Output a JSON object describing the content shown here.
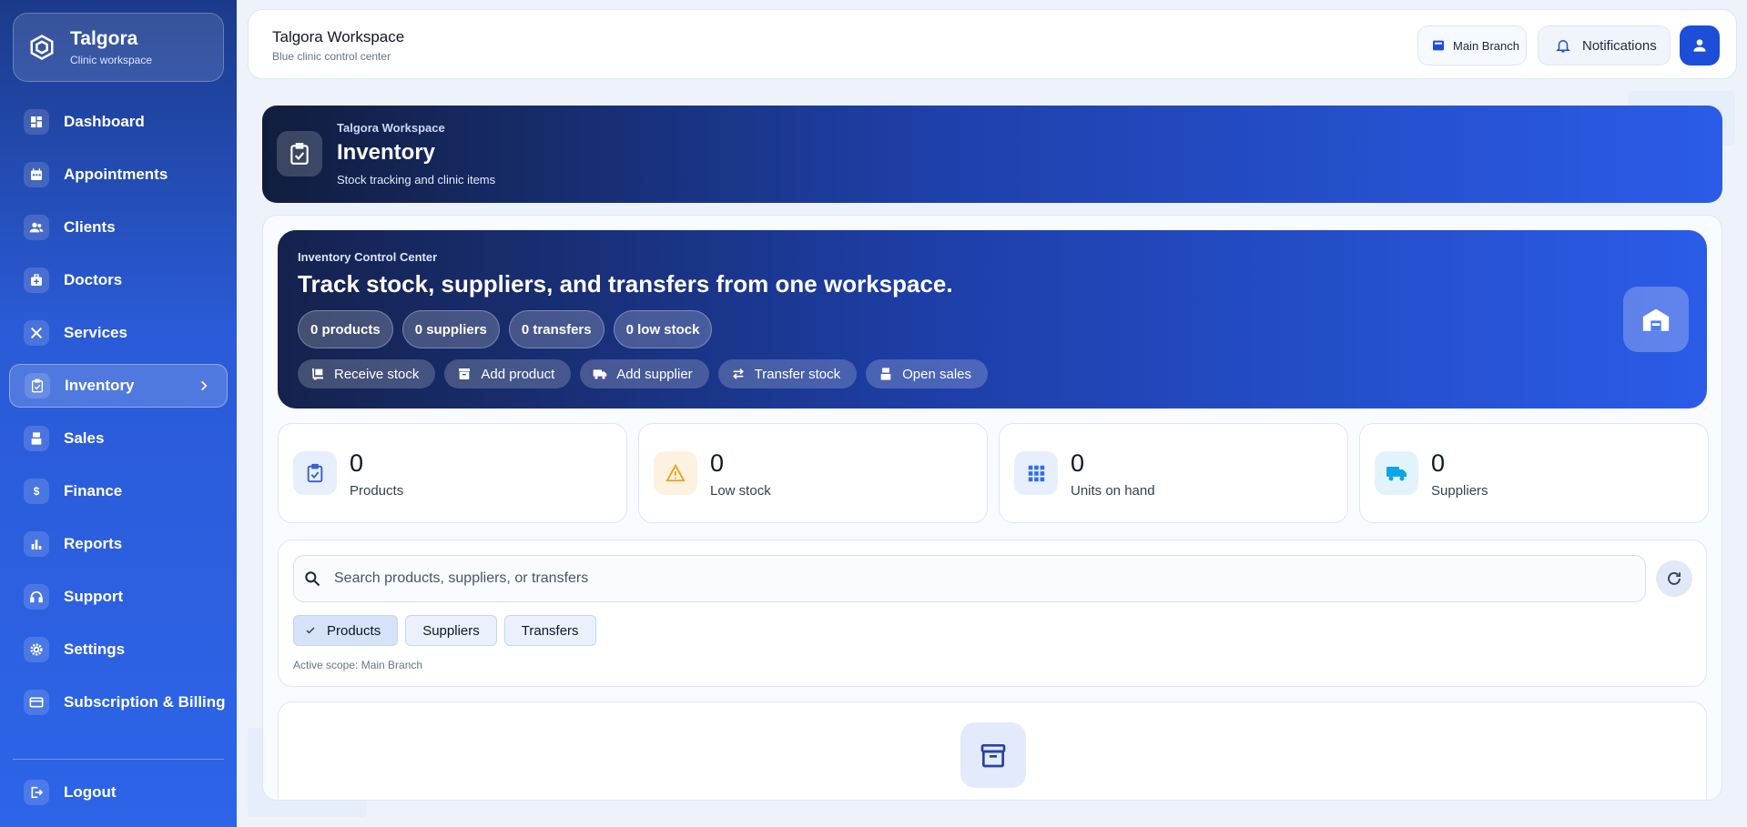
{
  "sidebar": {
    "brand_title": "Talgora",
    "brand_subtitle": "Clinic workspace",
    "items": [
      {
        "label": "Dashboard",
        "icon": "dashboard-icon"
      },
      {
        "label": "Appointments",
        "icon": "calendar-icon"
      },
      {
        "label": "Clients",
        "icon": "users-icon"
      },
      {
        "label": "Doctors",
        "icon": "medical-bag-icon"
      },
      {
        "label": "Services",
        "icon": "tools-icon"
      },
      {
        "label": "Inventory",
        "icon": "clipboard-check-icon",
        "active": true
      },
      {
        "label": "Sales",
        "icon": "register-icon"
      },
      {
        "label": "Finance",
        "icon": "dollar-icon"
      },
      {
        "label": "Reports",
        "icon": "bar-chart-icon"
      },
      {
        "label": "Support",
        "icon": "headset-icon"
      },
      {
        "label": "Settings",
        "icon": "gear-icon"
      },
      {
        "label": "Subscription & Billing",
        "icon": "credit-card-icon"
      }
    ],
    "logout_label": "Logout"
  },
  "topbar": {
    "title": "Talgora Workspace",
    "subtitle": "Blue clinic control center",
    "branch_label": "Main Branch",
    "notifications_label": "Notifications"
  },
  "page_header": {
    "kicker": "Talgora Workspace",
    "title": "Inventory",
    "subtitle": "Stock tracking and clinic items"
  },
  "control_center": {
    "kicker": "Inventory Control Center",
    "title": "Track stock, suppliers, and transfers from one workspace.",
    "chips": [
      "0 products",
      "0 suppliers",
      "0 transfers",
      "0 low stock"
    ],
    "actions": [
      "Receive stock",
      "Add product",
      "Add supplier",
      "Transfer stock",
      "Open sales"
    ]
  },
  "stats": [
    {
      "value": "0",
      "label": "Products",
      "color": "#2f5fd0",
      "bg": "#e7eefc"
    },
    {
      "value": "0",
      "label": "Low stock",
      "color": "#e8a21a",
      "bg": "#fdf2e0"
    },
    {
      "value": "0",
      "label": "Units on hand",
      "color": "#2f6fe8",
      "bg": "#e7eefc"
    },
    {
      "value": "0",
      "label": "Suppliers",
      "color": "#0ea5e9",
      "bg": "#e3f3fc"
    }
  ],
  "search": {
    "placeholder": "Search products, suppliers, or transfers",
    "value": ""
  },
  "tabs": [
    "Products",
    "Suppliers",
    "Transfers"
  ],
  "active_scope": "Active scope: Main Branch",
  "colors": {
    "accent": "#1d4ed8",
    "sidebar": "#2a5bd7"
  }
}
